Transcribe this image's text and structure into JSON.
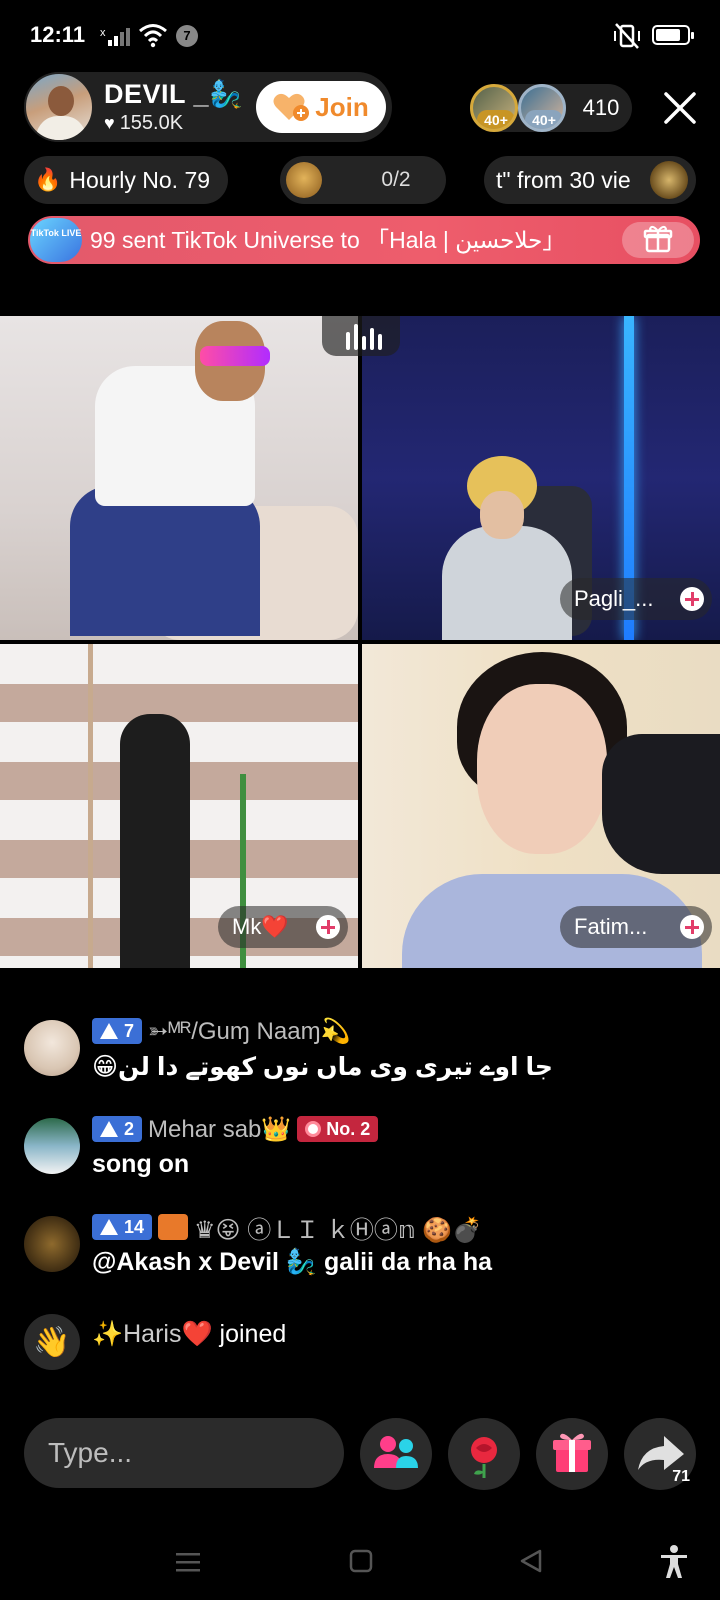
{
  "status_bar": {
    "time": "12:11",
    "notification_count": "7"
  },
  "host": {
    "name": "DEVIL _🧞‍♂️",
    "likes": "155.0K",
    "join_label": "Join"
  },
  "viewers": {
    "badges": [
      "40+",
      "40+"
    ],
    "count": "410"
  },
  "pills": {
    "hourly": "Hourly No. 79",
    "match_score": "0/2",
    "ticker": "t\" from 30 vie"
  },
  "gift_banner": {
    "logo_text": "TikTok LIVE",
    "text": "99 sent TikTok Universe to 「Hala | حلاحسین」"
  },
  "tiles": [
    {
      "label": ""
    },
    {
      "label": "Pagli_..."
    },
    {
      "label": "Mk❤️"
    },
    {
      "label": "Fatim..."
    }
  ],
  "chat": [
    {
      "level": "7",
      "username": "➳ᴹᴿ/Guɱ Naaɱ💫",
      "text": "جا اوے تیری وی ماں نوں کھوتے دا لن😁"
    },
    {
      "level": "2",
      "username": "Mehar sab👑",
      "rank_badge": "No. 2",
      "text": "song on"
    },
    {
      "level": "14",
      "username": "♛😝 ⓐＬＩ ｋⒽⓐ𝕟 🍪💣",
      "text": "@Akash x Devil 🧞‍♂️ galii da rha ha"
    },
    {
      "joined_user": "✨Haris❤️",
      "joined_verb": "joined"
    }
  ],
  "composer": {
    "placeholder": "Type...",
    "share_count": "71"
  },
  "colors": {
    "accent_join": "#f08a2c",
    "banner": "#ee5d6c",
    "level_badge": "#3b6fd6",
    "rank_badge": "#c4263e"
  }
}
